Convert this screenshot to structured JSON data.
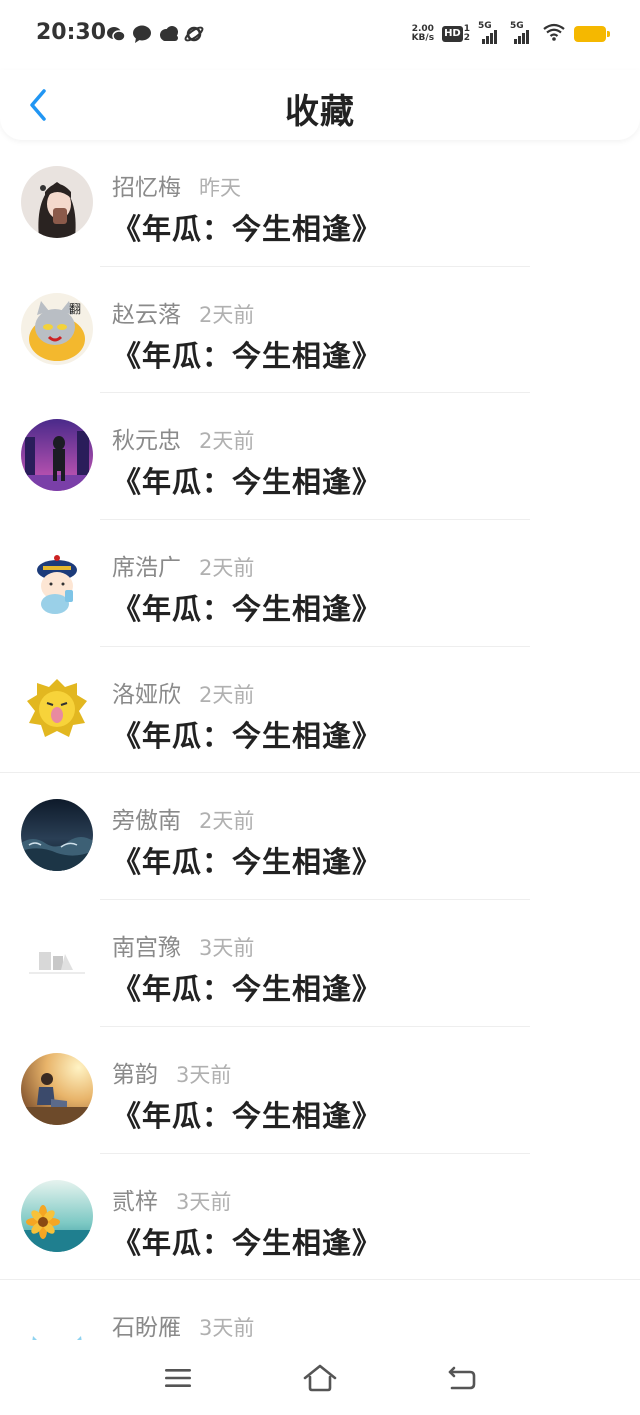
{
  "status": {
    "time": "20:30",
    "net_speed_value": "2.00",
    "net_speed_unit": "KB/s",
    "hd_label": "HD",
    "hd_sub_top": "1",
    "hd_sub_bottom": "2",
    "sig1_label": "5G",
    "sig2_label": "5G",
    "notification_icons": [
      "wechat-icon",
      "message-icon",
      "cloud-icon",
      "planet-icon"
    ],
    "battery_color": "#f5b800"
  },
  "header": {
    "back_icon": "chevron-left-icon",
    "title": "收藏",
    "accent_color": "#2196f3"
  },
  "favorites": [
    {
      "name": "招忆梅",
      "time": "昨天",
      "title": "《年瓜：今生相逢》",
      "avatar": "girl-photo"
    },
    {
      "name": "赵云落",
      "time": "2天前",
      "title": "《年瓜：今生相逢》",
      "avatar": "cartoon-cat"
    },
    {
      "name": "秋元忠",
      "time": "2天前",
      "title": "《年瓜：今生相逢》",
      "avatar": "night-city"
    },
    {
      "name": "席浩广",
      "time": "2天前",
      "title": "《年瓜：今生相逢》",
      "avatar": "qing-baby"
    },
    {
      "name": "洛娅欣",
      "time": "2天前",
      "title": "《年瓜：今生相逢》",
      "avatar": "yellow-lion"
    },
    {
      "name": "旁傲南",
      "time": "2天前",
      "title": "《年瓜：今生相逢》",
      "avatar": "stormy-sea"
    },
    {
      "name": "南宫豫",
      "time": "3天前",
      "title": "《年瓜：今生相逢》",
      "avatar": "white-sketch"
    },
    {
      "name": "第韵",
      "time": "3天前",
      "title": "《年瓜：今生相逢》",
      "avatar": "sunset-person"
    },
    {
      "name": "贰梓",
      "time": "3天前",
      "title": "《年瓜：今生相逢》",
      "avatar": "sunflower-sea"
    },
    {
      "name": "石盼雁",
      "time": "3天前",
      "title": "",
      "avatar": "blue-cat"
    }
  ],
  "nav": {
    "menu_icon": "menu-icon",
    "home_icon": "home-icon",
    "back_icon": "return-icon"
  }
}
